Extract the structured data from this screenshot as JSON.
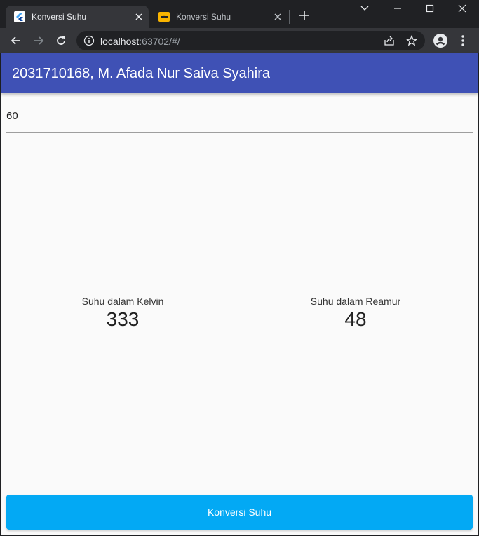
{
  "browser": {
    "tabs": [
      {
        "title": "Konversi Suhu",
        "active": true,
        "favicon": "flutter-logo-icon"
      },
      {
        "title": "Konversi Suhu",
        "active": false,
        "favicon": "link-icon"
      }
    ],
    "url_host": "localhost",
    "url_rest": ":63702/#/"
  },
  "app": {
    "title": "2031710168, M. Afada Nur Saiva Syahira",
    "input_value": "60",
    "results": [
      {
        "label": "Suhu dalam Kelvin",
        "value": "333"
      },
      {
        "label": "Suhu dalam Reamur",
        "value": "48"
      }
    ],
    "button_label": "Konversi Suhu",
    "colors": {
      "appbar": "#3f51b5",
      "button": "#03a9f4",
      "background": "#fafafa"
    }
  }
}
